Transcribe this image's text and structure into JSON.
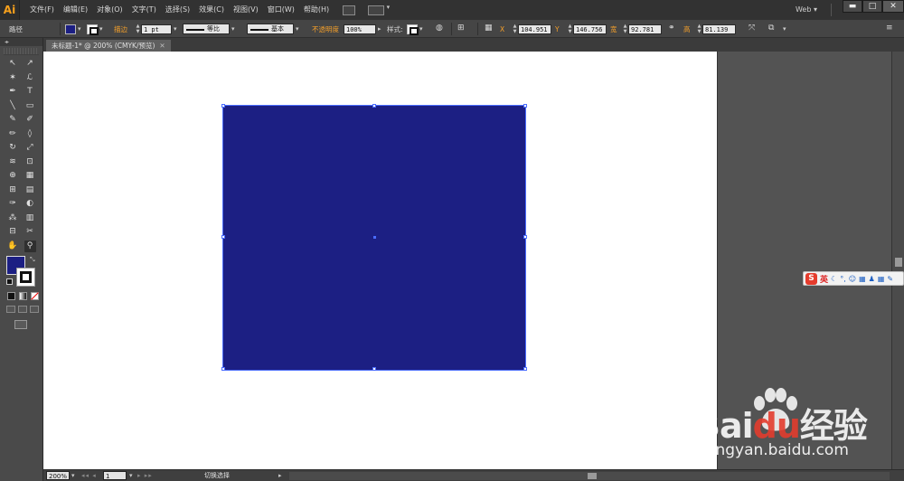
{
  "app": {
    "logo": "Ai",
    "workspace": "Web"
  },
  "menu": [
    "文件(F)",
    "编辑(E)",
    "对象(O)",
    "文字(T)",
    "选择(S)",
    "效果(C)",
    "视图(V)",
    "窗口(W)",
    "帮助(H)"
  ],
  "window_controls": {
    "minimize": "▬",
    "maximize": "□",
    "close": "✕"
  },
  "control_bar": {
    "selection_type": "路径",
    "stroke_label": "描边",
    "stroke_weight": "1 pt",
    "profile_label": "等比",
    "brush_label": "基本",
    "opacity_label": "不透明度",
    "opacity_value": "100%",
    "style_label": "样式:",
    "x_label": "X",
    "x_value": "104.951 m",
    "y_label": "Y",
    "y_value": "146.756 m",
    "w_label": "宽",
    "w_value": "92.781 m",
    "h_label": "高",
    "h_value": "81.139 m",
    "fill_color": "#1c1f83"
  },
  "document": {
    "tab_title": "未标题-1* @ 200% (CMYK/预览)",
    "tab_close": "✕",
    "rect_color": "#1c1f83",
    "selection_color": "#4a6cff"
  },
  "tools": [
    [
      "selection-tool-icon",
      "direct-selection-tool-icon"
    ],
    [
      "magic-wand-tool-icon",
      "lasso-tool-icon"
    ],
    [
      "pen-tool-icon",
      "type-tool-icon"
    ],
    [
      "line-tool-icon",
      "rectangle-tool-icon"
    ],
    [
      "paintbrush-tool-icon",
      "pencil-tool-icon"
    ],
    [
      "blob-brush-tool-icon",
      "eraser-tool-icon"
    ],
    [
      "rotate-tool-icon",
      "scale-tool-icon"
    ],
    [
      "width-tool-icon",
      "free-transform-tool-icon"
    ],
    [
      "shape-builder-tool-icon",
      "perspective-grid-tool-icon"
    ],
    [
      "mesh-tool-icon",
      "gradient-tool-icon"
    ],
    [
      "eyedropper-tool-icon",
      "blend-tool-icon"
    ],
    [
      "symbol-sprayer-tool-icon",
      "column-graph-tool-icon"
    ],
    [
      "artboard-tool-icon",
      "slice-tool-icon"
    ],
    [
      "hand-tool-icon",
      "zoom-tool-icon"
    ]
  ],
  "tool_glyphs": [
    [
      "↖",
      "↗"
    ],
    [
      "✶",
      "ℒ"
    ],
    [
      "✒",
      "T"
    ],
    [
      "╲",
      "▭"
    ],
    [
      "✎",
      "✐"
    ],
    [
      "✏",
      "◊"
    ],
    [
      "↻",
      "⤢"
    ],
    [
      "≋",
      "⊡"
    ],
    [
      "⊕",
      "▦"
    ],
    [
      "⊞",
      "▤"
    ],
    [
      "✑",
      "◐"
    ],
    [
      "⁂",
      "▥"
    ],
    [
      "⊟",
      "✂"
    ],
    [
      "✋",
      "⚲"
    ]
  ],
  "ime": {
    "lang": "英",
    "logo": "S"
  },
  "watermark": {
    "brand": "Bai",
    "brand_red": "du",
    "suffix": "经验",
    "url": "jingyan.baidu.com"
  },
  "status_bar": {
    "zoom": "200%",
    "page": "1",
    "status": "切换选择",
    "nav_prev": "◂◂ ◂",
    "nav_next": "▸ ▸▸",
    "dropdown": "▾",
    "arrow": "▸"
  }
}
